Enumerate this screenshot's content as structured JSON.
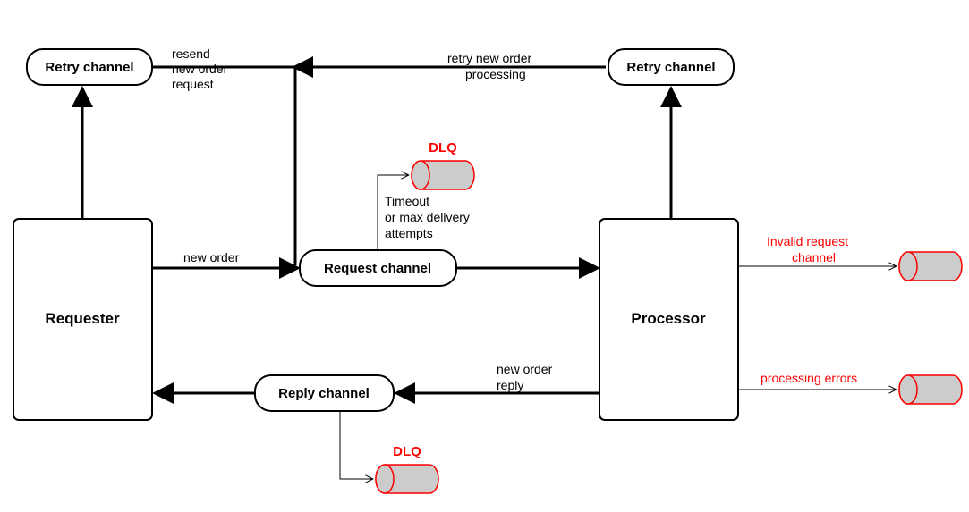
{
  "nodes": {
    "requester": "Requester",
    "processor": "Processor",
    "retry_left": "Retry channel",
    "retry_right": "Retry channel",
    "request_channel": "Request channel",
    "reply_channel": "Reply channel",
    "dlq_top": "DLQ",
    "dlq_bottom": "DLQ"
  },
  "edges": {
    "new_order": "new order",
    "resend_l1": "resend",
    "resend_l2": "new order",
    "resend_l3": "request",
    "retry_proc_l1": "retry new order",
    "retry_proc_l2": "processing",
    "timeout_l1": "Timeout",
    "timeout_l2": "or max delivery",
    "timeout_l3": "attempts",
    "new_order_reply_l1": "new order",
    "new_order_reply_l2": "reply",
    "invalid_req_l1": "Invalid request",
    "invalid_req_l2": "channel",
    "processing_errors": "processing errors"
  }
}
